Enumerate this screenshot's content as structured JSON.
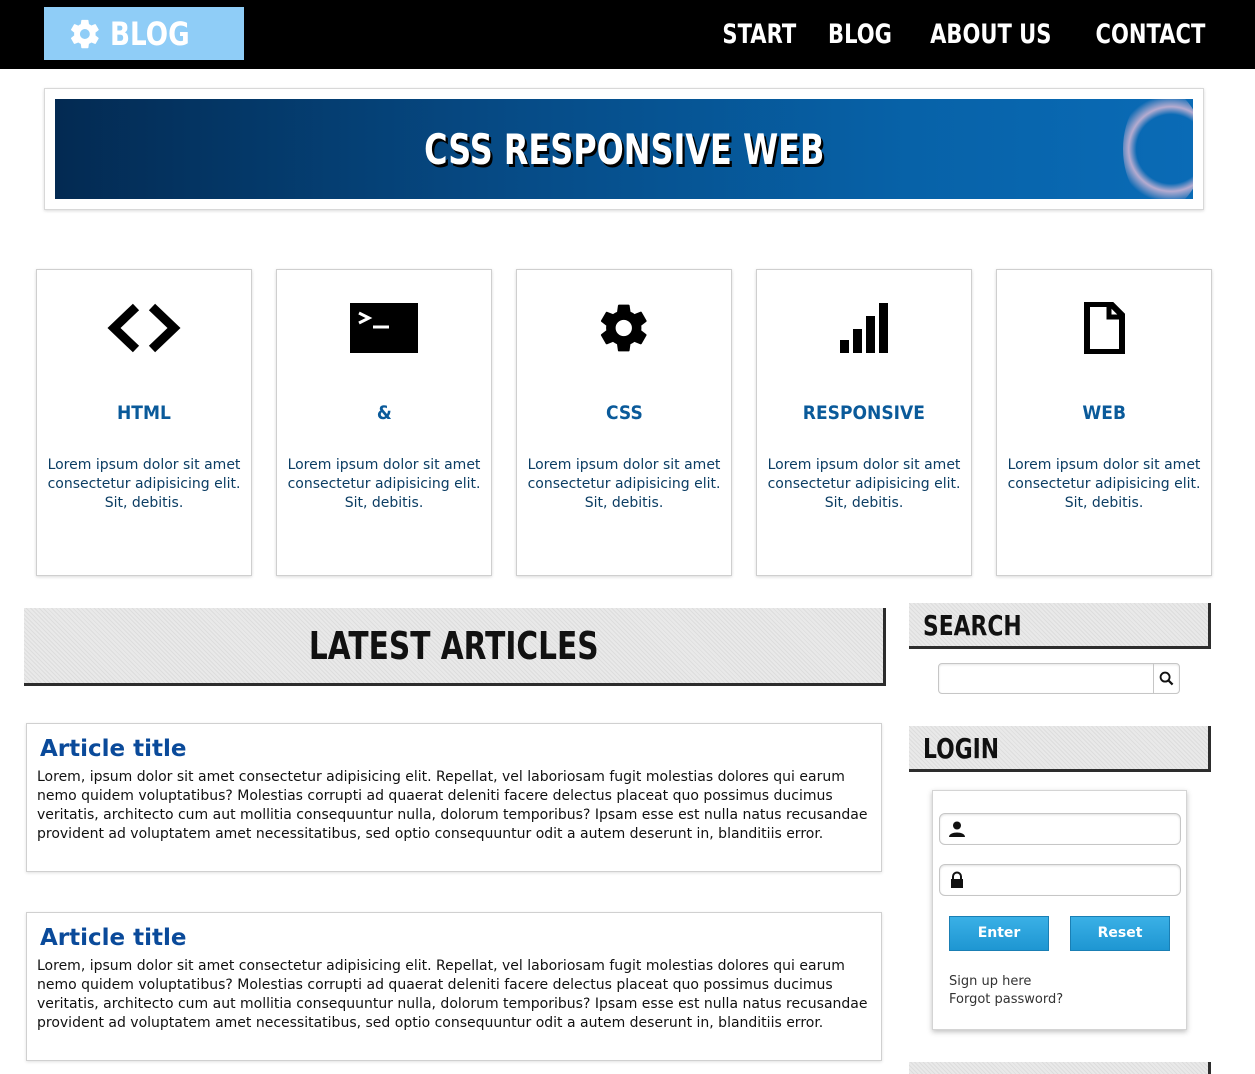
{
  "header": {
    "logo_text": "BLOG",
    "logo_icon": "gear-icon",
    "nav": [
      "START",
      "BLOG",
      "ABOUT US",
      "CONTACT"
    ]
  },
  "banner": {
    "title": "CSS RESPONSIVE WEB"
  },
  "features": [
    {
      "icon": "code-brackets-icon",
      "title": "HTML",
      "text": "Lorem ipsum dolor sit amet consectetur adipisicing elit. Sit, debitis."
    },
    {
      "icon": "terminal-icon",
      "title": "&",
      "text": "Lorem ipsum dolor sit amet consectetur adipisicing elit. Sit, debitis."
    },
    {
      "icon": "gear-icon",
      "title": "CSS",
      "text": "Lorem ipsum dolor sit amet consectetur adipisicing elit. Sit, debitis."
    },
    {
      "icon": "bar-chart-icon",
      "title": "RESPONSIVE",
      "text": "Lorem ipsum dolor sit amet consectetur adipisicing elit. Sit, debitis."
    },
    {
      "icon": "document-icon",
      "title": "WEB",
      "text": "Lorem ipsum dolor sit amet consectetur adipisicing elit. Sit, debitis."
    }
  ],
  "articles_section": {
    "title": "LATEST ARTICLES"
  },
  "articles": [
    {
      "title": "Article title",
      "body": "Lorem, ipsum dolor sit amet consectetur adipisicing elit. Repellat, vel laboriosam fugit molestias dolores qui earum nemo quidem voluptatibus? Molestias corrupti ad quaerat deleniti facere delectus placeat quo possimus ducimus veritatis, architecto cum aut mollitia consequuntur nulla, dolorum temporibus? Ipsam esse est nulla natus recusandae provident ad voluptatem amet necessitatibus, sed optio consequuntur odit a autem deserunt in, blanditiis error."
    },
    {
      "title": "Article title",
      "body": "Lorem, ipsum dolor sit amet consectetur adipisicing elit. Repellat, vel laboriosam fugit molestias dolores qui earum nemo quidem voluptatibus? Molestias corrupti ad quaerat deleniti facere delectus placeat quo possimus ducimus veritatis, architecto cum aut mollitia consequuntur nulla, dolorum temporibus? Ipsam esse est nulla natus recusandae provident ad voluptatem amet necessitatibus, sed optio consequuntur odit a autem deserunt in, blanditiis error."
    }
  ],
  "sidebar": {
    "search_title": "SEARCH",
    "search_value": "",
    "login_title": "LOGIN",
    "username_value": "",
    "password_value": "",
    "enter_label": "Enter",
    "reset_label": "Reset",
    "signup_link": "Sign up here",
    "forgot_link": "Forgot password?"
  },
  "colors": {
    "accent": "#8fcdf7",
    "heading_blue": "#0a5a9a",
    "button_blue": "#2aa3dc"
  }
}
